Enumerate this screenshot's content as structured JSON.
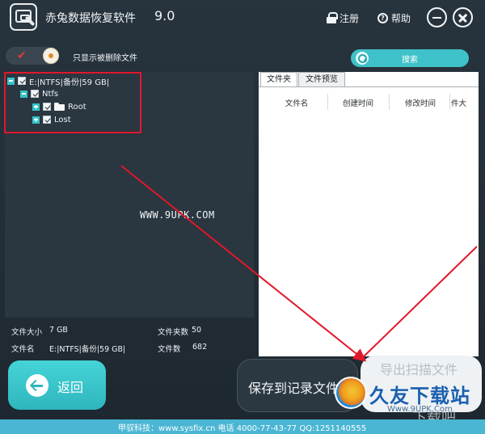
{
  "app": {
    "title": "赤兔数据恢复软件",
    "version": "9.0",
    "register_label": "注册",
    "help_label": "帮助"
  },
  "filter": {
    "toggle_on": true,
    "only_deleted_label": "只显示被删除文件"
  },
  "search": {
    "label": "搜索"
  },
  "tree": {
    "root": "E:|NTFS|备份|59 GB|",
    "child": "Ntfs",
    "items": [
      "Root",
      "Lost"
    ]
  },
  "watermark": "WWW.9UPK.COM",
  "stats": {
    "file_size_label": "文件大小",
    "file_size_value": "7 GB",
    "folder_count_label": "文件夹数",
    "folder_count_value": "50",
    "file_name_label": "文件名",
    "file_name_value": "E:|NTFS|备份|59 GB|",
    "file_count_label": "文件数",
    "file_count_value": "682"
  },
  "tabs": [
    "文件夹",
    "文件预览"
  ],
  "columns": [
    "文件名",
    "创建时间",
    "修改时间",
    "件大"
  ],
  "buttons": {
    "back": "返回",
    "save_log": "保存到记录文件",
    "export": "导出扫描文件"
  },
  "site_logo": {
    "title": "久友下载站",
    "url": "Www.9UPK.Com",
    "faint": "下载吧"
  },
  "footer": "甲驭科技：www.sysfix.cn 电话 4000-77-43-77 QQ:1251140555",
  "colors": {
    "accent": "#3ec1c9",
    "background": "#27333d",
    "annotation": "#e0182a",
    "footer": "#4ab6d4"
  }
}
